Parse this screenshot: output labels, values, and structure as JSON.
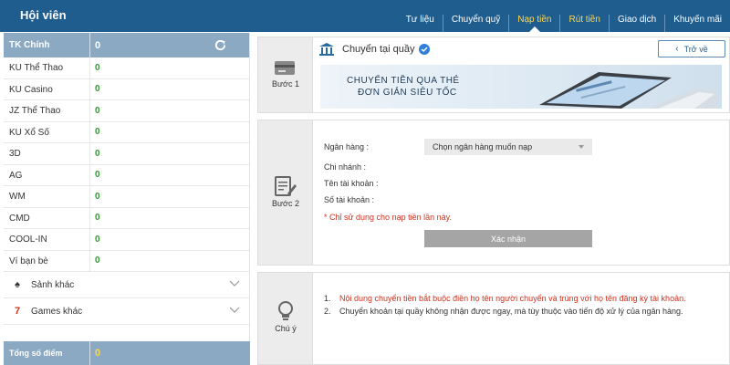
{
  "header": {
    "title": "Hội viên",
    "nav": [
      {
        "label": "Tư liệu",
        "state": "normal"
      },
      {
        "label": "Chuyển quỹ",
        "state": "normal"
      },
      {
        "label": "Nạp tiền",
        "state": "active"
      },
      {
        "label": "Rút tiền",
        "state": "highlight"
      },
      {
        "label": "Giao dịch",
        "state": "normal"
      },
      {
        "label": "Khuyến mãi",
        "state": "normal"
      }
    ]
  },
  "sidebar": {
    "main_account": {
      "label": "TK Chính",
      "value": "0",
      "icon": "refresh-icon"
    },
    "accounts": [
      {
        "label": "KU Thể Thao",
        "value": "0"
      },
      {
        "label": "KU Casino",
        "value": "0"
      },
      {
        "label": "JZ Thể Thao",
        "value": "0"
      },
      {
        "label": "KU Xổ Số",
        "value": "0"
      },
      {
        "label": "3D",
        "value": "0"
      },
      {
        "label": "AG",
        "value": "0"
      },
      {
        "label": "WM",
        "value": "0"
      },
      {
        "label": "CMD",
        "value": "0"
      },
      {
        "label": "COOL-IN",
        "value": "0"
      },
      {
        "label": "Ví bạn bè",
        "value": "0"
      }
    ],
    "more": [
      {
        "label": "Sảnh khác",
        "icon": "spade-icon"
      },
      {
        "label": "Games khác",
        "icon": "lucky-seven-icon"
      }
    ],
    "total": {
      "label": "Tổng số điểm",
      "value": "0"
    }
  },
  "step1": {
    "label": "Bước 1",
    "method": "Chuyển tại quầy",
    "back_label": "Trở về",
    "banner_line1": "CHUYỂN TIỀN QUA THẺ",
    "banner_line2": "ĐƠN GIẢN SIÊU TỐC"
  },
  "step2": {
    "label": "Bước 2",
    "bank_label": "Ngân hàng :",
    "bank_select": "Chọn ngân hàng muốn nạp",
    "branch_label": "Chi nhánh :",
    "account_name_label": "Tên tài khoản :",
    "account_number_label": "Số tài khoản :",
    "note": "* Chỉ sử dụng cho nạp tiền lần này.",
    "confirm_label": "Xác nhận"
  },
  "notes": {
    "label": "Chú ý",
    "items": [
      {
        "num": "1.",
        "text": "Nội dung chuyển tiền bắt buộc điền họ tên người chuyển và trùng với họ tên đăng ký tài khoản."
      },
      {
        "num": "2.",
        "text": "Chuyển khoản tại quầy không nhận được ngay, mà tùy thuộc vào tiến độ xử lý của ngân hàng."
      }
    ]
  },
  "colors": {
    "header_bg": "#1f5d8f",
    "sidebar_accent": "#8ba9c2",
    "balance_green": "#2e9a2e",
    "warning_red": "#d0311e",
    "active_yellow": "#ffd84a"
  }
}
